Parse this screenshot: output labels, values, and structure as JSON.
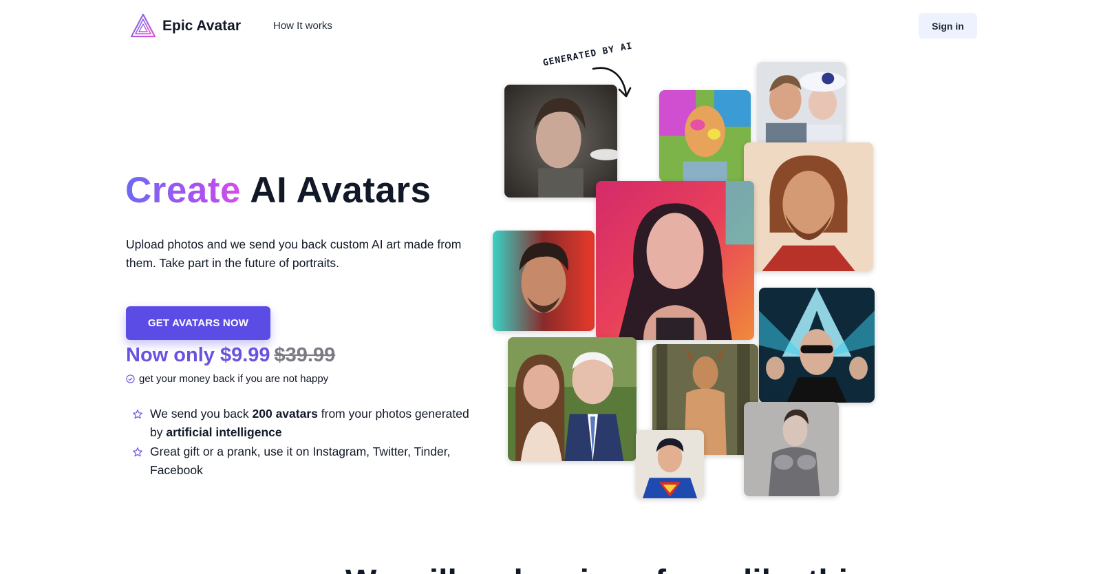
{
  "header": {
    "brand": "Epic Avatar",
    "nav": [
      "How It works"
    ],
    "signin_label": "Sign in"
  },
  "hero": {
    "title_highlight": "Create",
    "title_rest": "AI Avatars",
    "subtitle": "Upload photos and we send you back custom AI art made from them. Take part in the future of portraits.",
    "cta_label": "GET AVATARS NOW",
    "price_now": "Now only $9.99",
    "price_old": "$39.99",
    "guarantee": "get your money back if you are not happy",
    "features": [
      {
        "pre": "We send you back ",
        "bold1": "200 avatars",
        "mid": " from your photos generated by ",
        "bold2": "artificial intelligence"
      },
      {
        "pre": "Great gift or a prank, use it on Instagram, Twitter, Tinder, Facebook",
        "bold1": "",
        "mid": "",
        "bold2": ""
      }
    ]
  },
  "collage": {
    "label": "GENERATED BY AI"
  },
  "section": {
    "title": "We will make pics of you like this"
  },
  "colors": {
    "accent": "#5b4ce6",
    "price": "#6a52e0",
    "signin_bg": "#eef2ff"
  }
}
